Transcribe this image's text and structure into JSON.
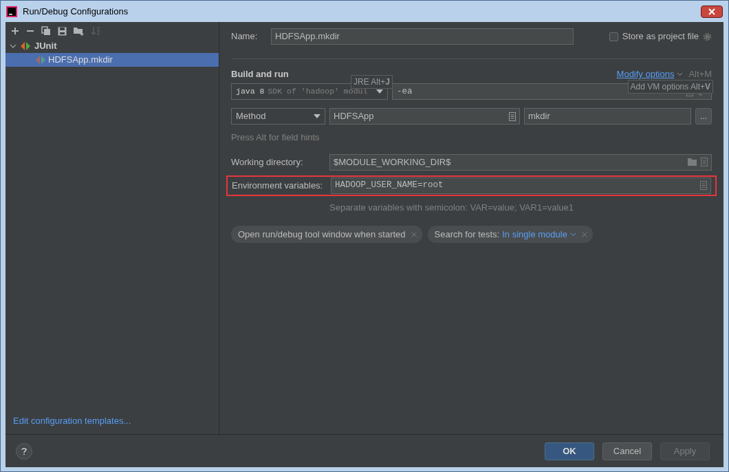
{
  "window": {
    "title": "Run/Debug Configurations"
  },
  "tree": [
    {
      "label": "JUnit",
      "expanded": true,
      "selected": false,
      "children": [
        {
          "label": "HDFSApp.mkdir",
          "selected": true
        }
      ]
    }
  ],
  "edit_templates_link": "Edit configuration templates...",
  "name_field": {
    "label": "Name:",
    "value": "HDFSApp.mkdir"
  },
  "store_as_project_file": {
    "label": "Store as project file",
    "checked": false
  },
  "build_and_run": {
    "title": "Build and run",
    "modify_options": "Modify options",
    "modify_shortcut": "Alt+M",
    "jre": {
      "value": "java 8",
      "hint": "SDK of 'hadoop' modul"
    },
    "vm_options": "-ea",
    "test_kind": "Method",
    "class": "HDFSApp",
    "method": "mkdir",
    "more_button": "...",
    "hint": "Press Alt for field hints"
  },
  "working_directory": {
    "label": "Working directory:",
    "value": "$MODULE_WORKING_DIR$"
  },
  "environment_variables": {
    "label": "Environment variables:",
    "value": "HADOOP_USER_NAME=root",
    "highlighted": true,
    "hint": "Separate variables with semicolon: VAR=value; VAR1=value1"
  },
  "option_chips": [
    {
      "label": "Open run/debug tool window when started"
    },
    {
      "label": "Search for tests:",
      "value": "In single module"
    }
  ],
  "tooltips": [
    {
      "text": "JRE Alt+**J**"
    },
    {
      "text": "Add VM options Alt+**V**"
    }
  ],
  "buttons": [
    {
      "label": "OK",
      "kind": "primary",
      "disabled": false
    },
    {
      "label": "Cancel",
      "kind": "normal",
      "disabled": false
    },
    {
      "label": "Apply",
      "kind": "normal",
      "disabled": true
    }
  ]
}
